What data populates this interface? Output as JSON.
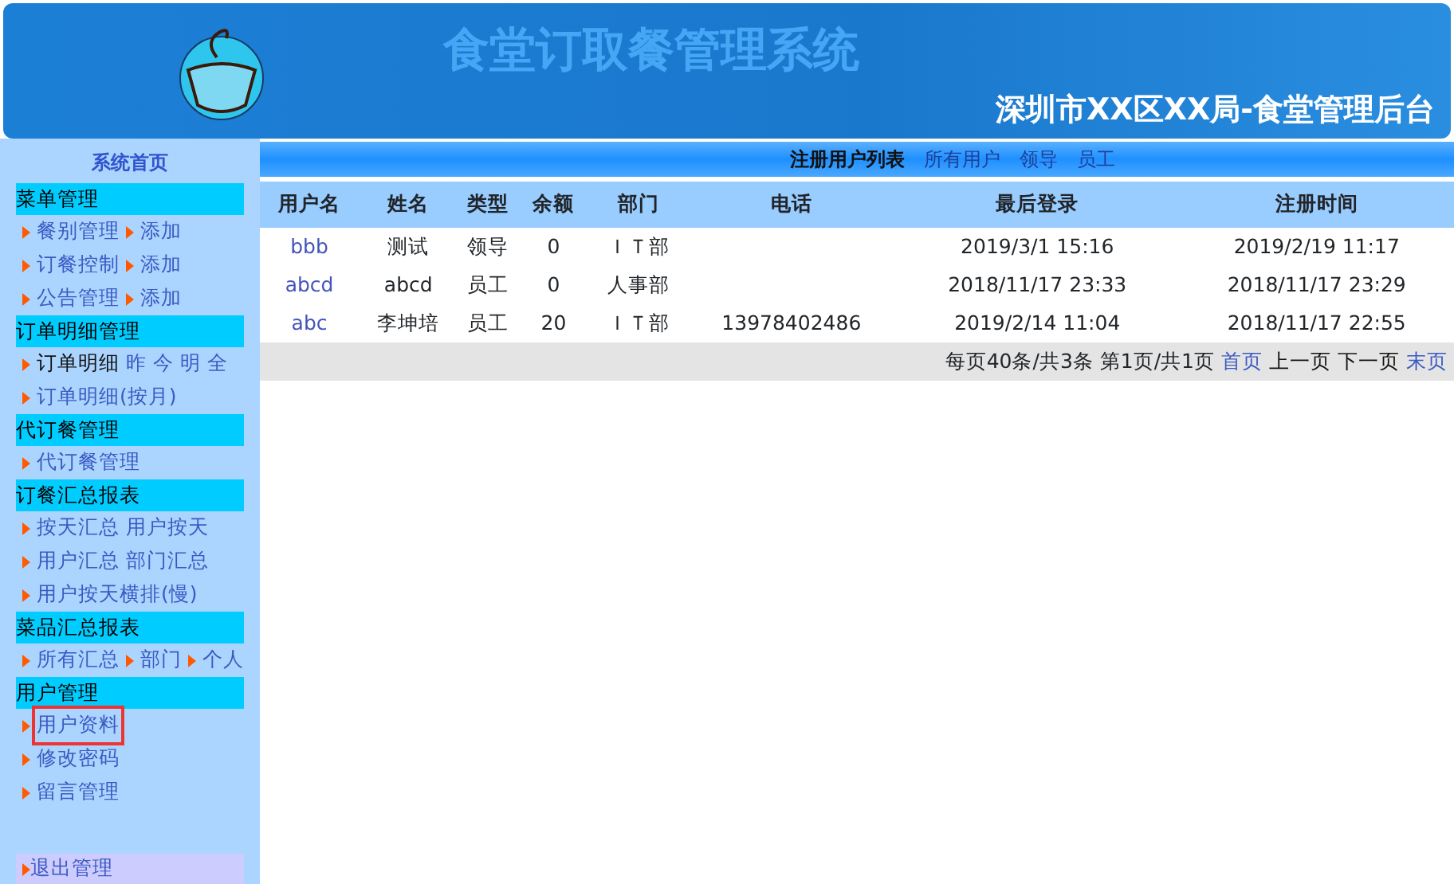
{
  "header": {
    "title": "食堂订取餐管理系统",
    "subtitle": "深圳市XX区XX局-食堂管理后台"
  },
  "sidebar": {
    "home": "系统首页",
    "sections": [
      {
        "title": "菜单管理",
        "lines": [
          [
            {
              "label": "餐别管理",
              "arrow": true
            },
            {
              "label": "添加",
              "arrow": true
            }
          ],
          [
            {
              "label": "订餐控制",
              "arrow": true
            },
            {
              "label": "添加",
              "arrow": true
            }
          ],
          [
            {
              "label": "公告管理",
              "arrow": true
            },
            {
              "label": "添加",
              "arrow": true
            }
          ]
        ]
      },
      {
        "title": "订单明细管理",
        "lines": [
          [
            {
              "label": "订单明细",
              "arrow": true,
              "current": true
            },
            {
              "label": "昨",
              "arrow": false
            },
            {
              "label": "今",
              "arrow": false
            },
            {
              "label": "明",
              "arrow": false
            },
            {
              "label": "全",
              "arrow": false
            }
          ],
          [
            {
              "label": "订单明细(按月)",
              "arrow": true
            }
          ]
        ]
      },
      {
        "title": "代订餐管理",
        "lines": [
          [
            {
              "label": "代订餐管理",
              "arrow": true
            }
          ]
        ]
      },
      {
        "title": "订餐汇总报表",
        "lines": [
          [
            {
              "label": "按天汇总",
              "arrow": true
            },
            {
              "label": "用户按天",
              "arrow": false
            }
          ],
          [
            {
              "label": "用户汇总",
              "arrow": true
            },
            {
              "label": "部门汇总",
              "arrow": false
            }
          ],
          [
            {
              "label": "用户按天横排(慢)",
              "arrow": true
            }
          ]
        ]
      },
      {
        "title": "菜品汇总报表",
        "lines": [
          [
            {
              "label": "所有汇总",
              "arrow": true
            },
            {
              "label": "部门",
              "arrow": true
            },
            {
              "label": "个人",
              "arrow": true
            }
          ]
        ]
      },
      {
        "title": "用户管理",
        "lines": [
          [
            {
              "label": "用户资料",
              "arrow": true,
              "highlighted": true
            }
          ],
          [
            {
              "label": "修改密码",
              "arrow": true
            }
          ],
          [
            {
              "label": "留言管理",
              "arrow": true
            }
          ]
        ]
      }
    ],
    "exit": "退出管理"
  },
  "main": {
    "title": "注册用户列表",
    "filters": [
      "所有用户",
      "领导",
      "员工"
    ],
    "columns": [
      "用户名",
      "姓名",
      "类型",
      "余额",
      "部门",
      "电话",
      "最后登录",
      "注册时间"
    ],
    "rows": [
      [
        "bbb",
        "测试",
        "领导",
        "0",
        "ＩＴ部",
        "",
        "2019/3/1 15:16",
        "2019/2/19 11:17"
      ],
      [
        "abcd",
        "abcd",
        "员工",
        "0",
        "人事部",
        "",
        "2018/11/17 23:33",
        "2018/11/17 23:29"
      ],
      [
        "abc",
        "李坤培",
        "员工",
        "20",
        "ＩＴ部",
        "13978402486",
        "2019/2/14 11:04",
        "2018/11/17 22:55"
      ]
    ],
    "pager": {
      "summary": "每页40条/共3条 第1页/共1页",
      "links": [
        {
          "label": "首页",
          "disabled": false
        },
        {
          "label": "上一页",
          "disabled": true
        },
        {
          "label": "下一页",
          "disabled": true
        },
        {
          "label": "末页",
          "disabled": false
        }
      ]
    }
  }
}
